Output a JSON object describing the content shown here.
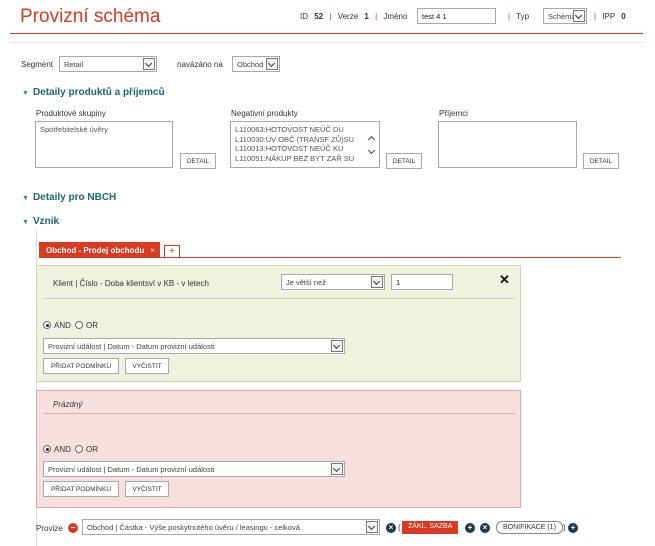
{
  "header": {
    "title": "Provizní schéma",
    "id_label": "ID",
    "id_value": "52",
    "version_label": "Verze",
    "version_value": "1",
    "name_label": "Jméno",
    "name_value": "test 4 1",
    "type_label": "Typ",
    "type_value": "Schéma",
    "ipp_label": "IPP",
    "ipp_value": "0",
    "separator": "|"
  },
  "segment": {
    "label": "Segment",
    "value": "Retail",
    "linked_label": "navázáno na",
    "linked_value": "Obchod"
  },
  "details_products": {
    "title": "Detaily produktů a příjemců",
    "product_groups_label": "Produktové skupiny",
    "product_groups_items": [
      "Spotřebitelské úvěry"
    ],
    "negative_products_label": "Negativní produkty",
    "negative_products_items": [
      "L110063:HOTOVOST NEÚČ DU",
      "L110030:ÚV OBČ (TRANSF ZŮ)SU",
      "L110013:HOTOVOST NEÚČ KU",
      "L110051:NÁKUP BEZ BYT ZAŘ SU"
    ],
    "recipients_label": "Příjemci",
    "detail_button": "DETAIL"
  },
  "nbch": {
    "title": "Detaily pro NBCH"
  },
  "vznik": {
    "title": "Vznik",
    "tab_label": "Obchod - Prodej obchodu",
    "tab_close": "×",
    "tab_add": "+",
    "condition": {
      "field": "Klient | Číslo - Doba klientsví v KB - v letech",
      "operator": "Je větší než",
      "value": "1",
      "close": "✕"
    },
    "and_label": "AND",
    "or_label": "OR",
    "event_select": "Provizní událost | Datum - Datum provizní události",
    "add_condition": "PŘIDAT PODMÍNKU",
    "clear": "VYČISTIT",
    "empty_label": "Prázdný"
  },
  "provize": {
    "label": "Provize",
    "select": "Obchod | Částka - Výše poskytnutého úvěru / leasingu - celková",
    "open_paren": "(",
    "close_paren": ")",
    "base_rate": "ZÁKL. SAZBA",
    "bonus": "BONIFIKACE (1)"
  },
  "colors": {
    "accent": "#d93a22",
    "section": "#1a6a6a",
    "green_panel": "#eef3df",
    "red_panel": "#f8dfdf"
  }
}
